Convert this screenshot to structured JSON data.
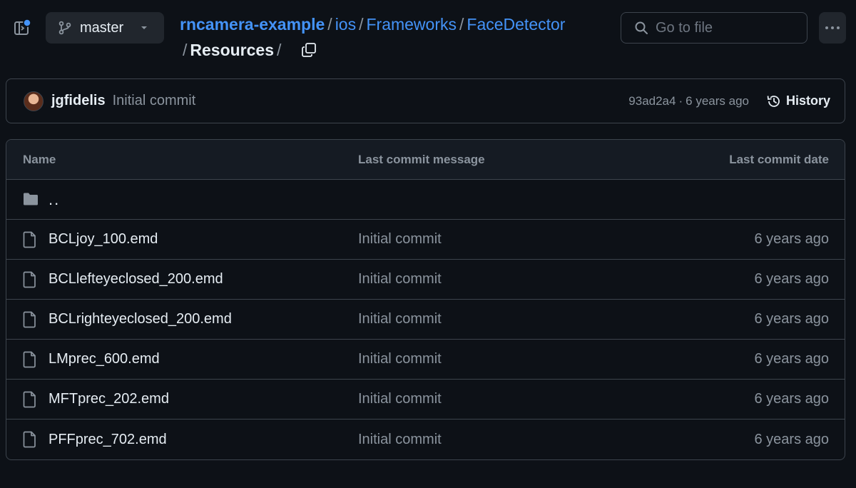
{
  "header": {
    "branch": "master",
    "breadcrumb": {
      "repo": "rncamera-example",
      "parts": [
        "ios",
        "Frameworks",
        "FaceDetector"
      ],
      "current": "Resources"
    },
    "search_placeholder": "Go to file"
  },
  "commit": {
    "author": "jgfidelis",
    "message": "Initial commit",
    "sha": "93ad2a4",
    "separator": "·",
    "time": "6 years ago",
    "history_label": "History"
  },
  "table": {
    "columns": {
      "name": "Name",
      "message": "Last commit message",
      "date": "Last commit date"
    },
    "parent_label": "..",
    "rows": [
      {
        "name": "BCLjoy_100.emd",
        "message": "Initial commit",
        "date": "6 years ago"
      },
      {
        "name": "BCLlefteyeclosed_200.emd",
        "message": "Initial commit",
        "date": "6 years ago"
      },
      {
        "name": "BCLrighteyeclosed_200.emd",
        "message": "Initial commit",
        "date": "6 years ago"
      },
      {
        "name": "LMprec_600.emd",
        "message": "Initial commit",
        "date": "6 years ago"
      },
      {
        "name": "MFTprec_202.emd",
        "message": "Initial commit",
        "date": "6 years ago"
      },
      {
        "name": "PFFprec_702.emd",
        "message": "Initial commit",
        "date": "6 years ago"
      }
    ]
  },
  "colors": {
    "background": "#0d1117",
    "link": "#4493f8",
    "border": "#3d444d",
    "muted_text": "#8b949e"
  }
}
